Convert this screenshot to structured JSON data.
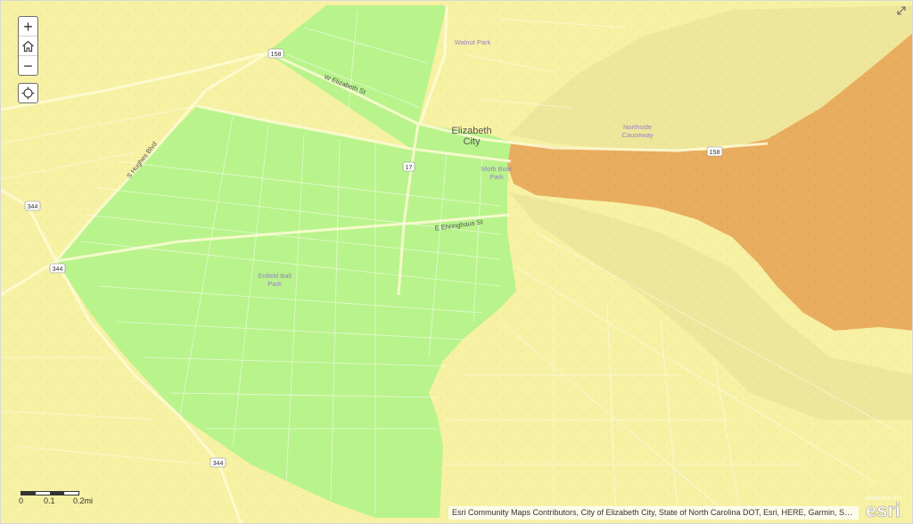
{
  "map": {
    "labels": {
      "city_line1": "Elizabeth",
      "city_line2": "City",
      "walnut_park": "Walnut Park",
      "northside_line1": "Northside",
      "northside_line2": "Causeway",
      "moth_boat_line1": "Moth Boat",
      "moth_boat_line2": "Park",
      "enfield_line1": "Enfield Ball",
      "enfield_line2": "Park",
      "w_elizabeth_st": "W Elizabeth St",
      "e_ehringhaus_st": "E Ehringhaus St",
      "s_hughes_blvd": "S Hughes Blvd"
    },
    "route_shields": {
      "us158_west": "158",
      "us158_east": "158",
      "us17": "17",
      "nc344_north": "344",
      "nc344_mid": "344",
      "nc344_south": "344"
    },
    "colors": {
      "yellow_zone": "#f7f1a4",
      "green_zone": "#b9f38c",
      "orange_zone": "#e9ad5f",
      "water_tint": "#eee79b",
      "place_label": "#9a7ec9",
      "city_label": "#555555"
    }
  },
  "controls": {
    "zoom_in": "+",
    "zoom_out": "−",
    "home_icon": "home-icon",
    "locate_icon": "locate-icon",
    "expand_icon": "expand-icon"
  },
  "scale": {
    "label_0": "0",
    "label_1": "0.1",
    "label_2": "0.2mi"
  },
  "attribution": "Esri Community Maps Contributors, City of Elizabeth City, State of North Carolina DOT, Esri, HERE, Garmin, SafeGraph, GeoTechnologi...",
  "logo": {
    "powered": "POWERED BY",
    "text": "esri"
  }
}
